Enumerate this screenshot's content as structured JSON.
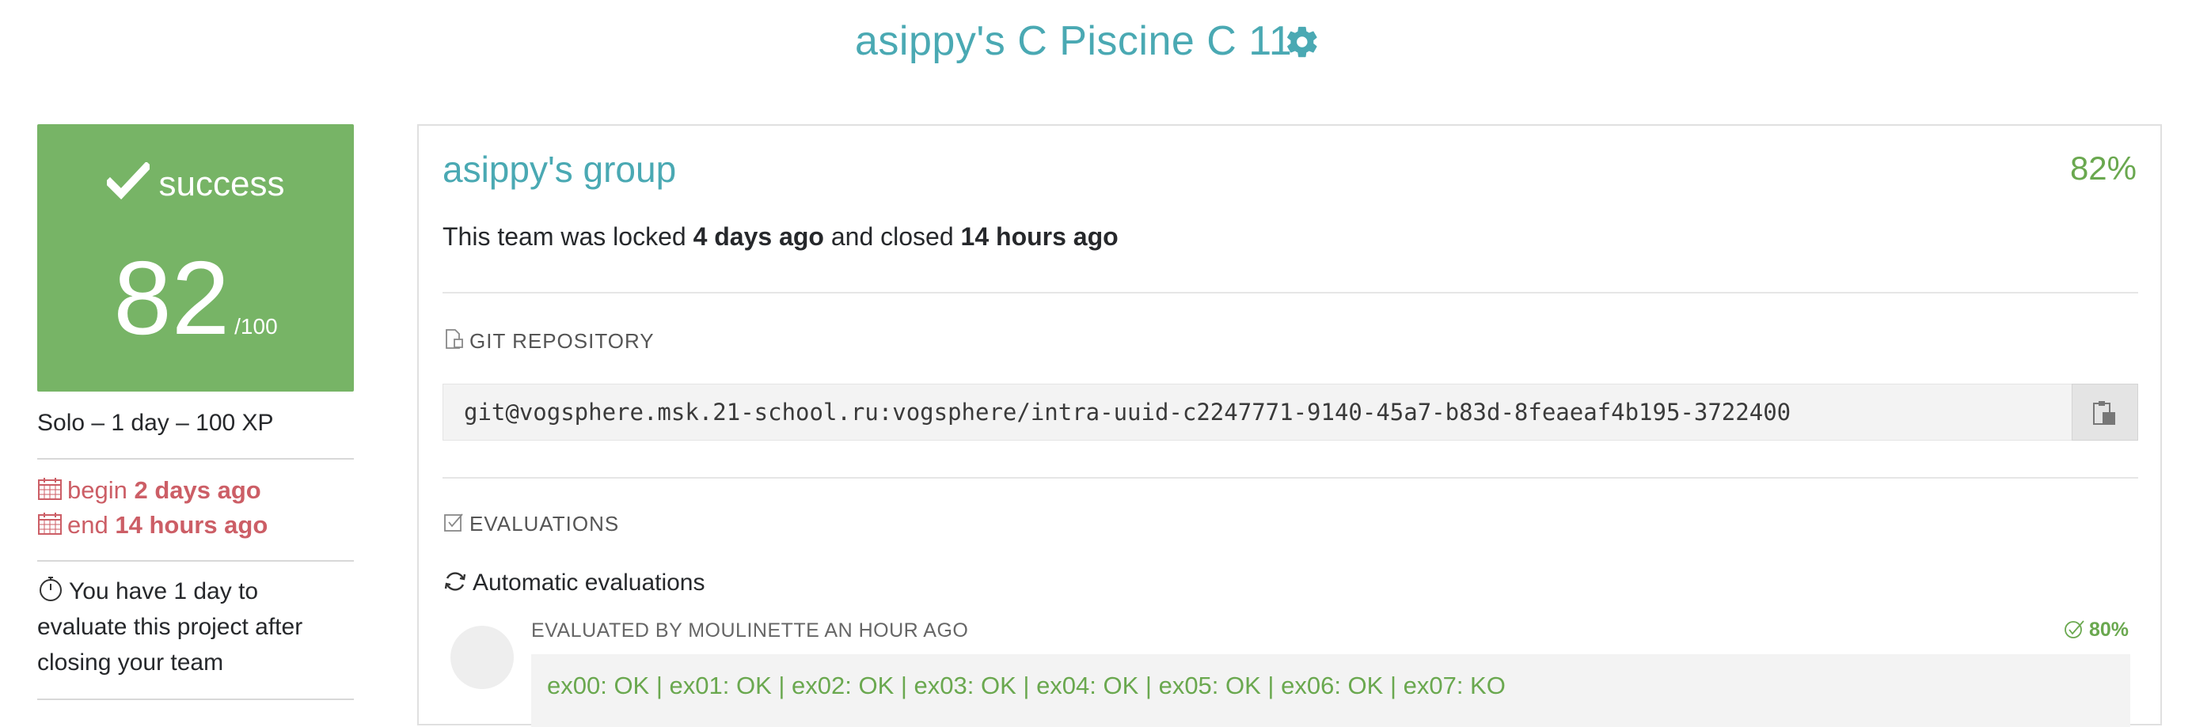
{
  "header": {
    "title": "asippy's C Piscine C 11",
    "settings_icon": "gear-icon"
  },
  "status_card": {
    "status": "success",
    "score": "82",
    "max": "/100",
    "color": "#77b466"
  },
  "project_meta": {
    "summary": "Solo – 1 day – 100 XP",
    "begin_label": "begin",
    "begin_value": "2 days ago",
    "end_label": "end",
    "end_value": "14 hours ago",
    "evaluation_note": "You have 1 day to evaluate this project after closing your team"
  },
  "team": {
    "name": "asippy's group",
    "percent": "82%",
    "lock_prefix": "This team was locked",
    "locked_ago": "4 days ago",
    "lock_middle": "and closed",
    "closed_ago": "14 hours ago"
  },
  "git": {
    "heading": "GIT REPOSITORY",
    "url": "git@vogsphere.msk.21-school.ru:vogsphere/intra-uuid-c2247771-9140-45a7-b83d-8feaeaf4b195-3722400"
  },
  "evaluations": {
    "heading": "EVALUATIONS",
    "automatic_label": "Automatic evaluations",
    "items": [
      {
        "evaluated_by": "EVALUATED BY MOULINETTE AN HOUR AGO",
        "percent": "80%",
        "result": "ex00: OK | ex01: OK | ex02: OK | ex03: OK | ex04: OK | ex05: OK | ex06: OK | ex07: KO"
      }
    ]
  },
  "colors": {
    "accent": "#4aa9b3",
    "success": "#6aa84f",
    "danger": "#cc5e66"
  }
}
